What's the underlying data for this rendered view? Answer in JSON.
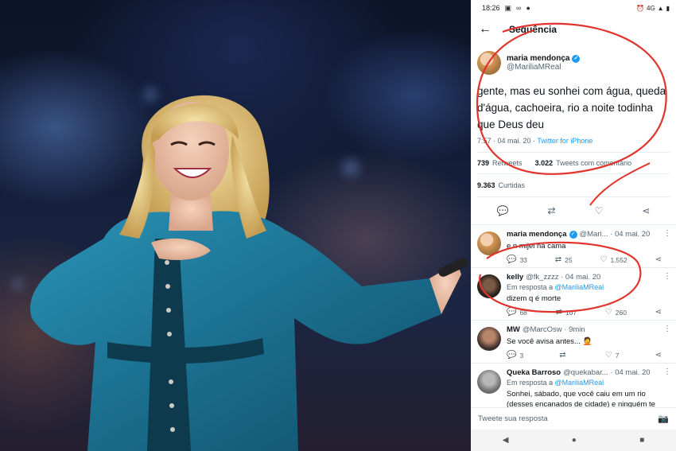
{
  "status_bar": {
    "time": "18:26",
    "network": "4G"
  },
  "header": {
    "title": "Sequência"
  },
  "main_tweet": {
    "author_name": "maria mendonça",
    "author_handle": "@MariliaMReal",
    "text": "gente, mas eu sonhei com água, queda d'água, cachoeira, rio a noite todinha que Deus deu",
    "timestamp": "7:57 · 04 mai. 20 · ",
    "source": "Twitter for iPhone",
    "retweets_count": "739",
    "retweets_label": "Retweets",
    "quotes_count": "3.022",
    "quotes_label": "Tweets com comentário",
    "likes_count": "9.363",
    "likes_label": "Curtidas"
  },
  "replies": [
    {
      "name": "maria mendonça",
      "meta": "@Mari... · 04 mai. 20",
      "reply_to_prefix": "",
      "reply_to_mention": "",
      "text": "e n mijei na cama",
      "replies": "33",
      "retweets": "25",
      "likes": "1.552"
    },
    {
      "name": "kelly",
      "meta": "@fk_zzzz · 04 mai. 20",
      "reply_to_prefix": "Em resposta a ",
      "reply_to_mention": "@MariliaMReal",
      "text": "dizem q é morte",
      "replies": "68",
      "retweets": "107",
      "likes": "260"
    },
    {
      "name": "MW",
      "meta": "@MarcOsw · 9min",
      "reply_to_prefix": "",
      "reply_to_mention": "",
      "text": "Se você avisa antes... 🤦",
      "replies": "3",
      "retweets": "",
      "likes": "7"
    },
    {
      "name": "Queka Barroso",
      "meta": "@quekabar... · 04 mai. 20",
      "reply_to_prefix": "Em resposta a ",
      "reply_to_mention": "@MariliaMReal",
      "text": "Sonhei, sábado, que você caiu em um rio (desses encanados de cidade) e ninguém te",
      "replies": "",
      "retweets": "",
      "likes": ""
    }
  ],
  "compose": {
    "placeholder": "Tweete sua resposta"
  },
  "icons": {
    "back": "arrow-left",
    "verified": "verified-badge",
    "reply": "speech-bubble",
    "retweet": "retweet-arrows",
    "like": "heart",
    "share": "share-nodes",
    "camera": "camera",
    "more": "kebab-vertical"
  },
  "colors": {
    "accent": "#1d9bf0",
    "annotation": "#e0342c",
    "dress": "#1f7fa0"
  }
}
